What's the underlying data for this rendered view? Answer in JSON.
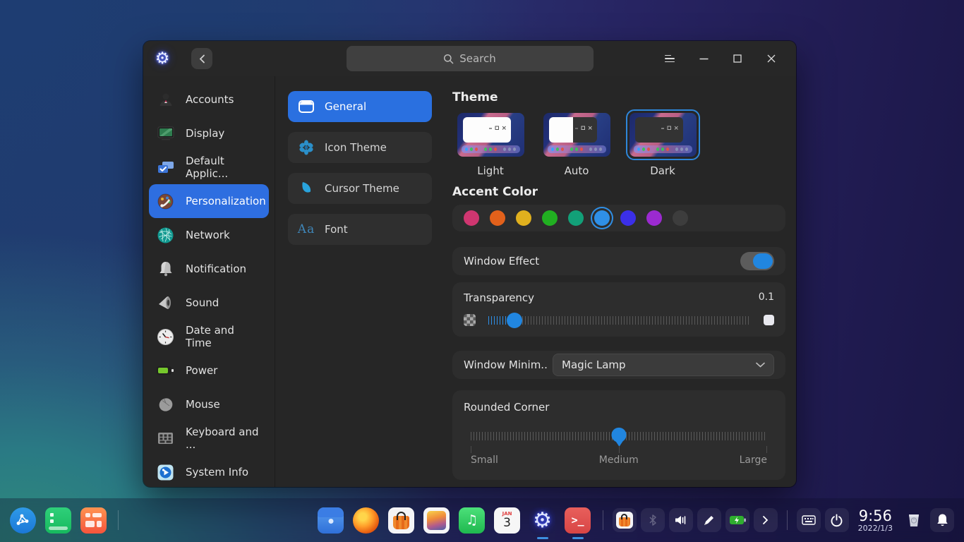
{
  "titlebar": {
    "search_placeholder": "Search"
  },
  "sidebar": {
    "items": [
      {
        "icon": "user-icon",
        "label": "Accounts"
      },
      {
        "icon": "display-icon",
        "label": "Display"
      },
      {
        "icon": "default-apps-icon",
        "label": "Default Applic..."
      },
      {
        "icon": "personalization-icon",
        "label": "Personalization",
        "selected": true
      },
      {
        "icon": "network-icon",
        "label": "Network"
      },
      {
        "icon": "notification-icon",
        "label": "Notification"
      },
      {
        "icon": "sound-icon",
        "label": "Sound"
      },
      {
        "icon": "clock-icon",
        "label": "Date and Time"
      },
      {
        "icon": "battery-icon",
        "label": "Power"
      },
      {
        "icon": "mouse-icon",
        "label": "Mouse"
      },
      {
        "icon": "keyboard-icon",
        "label": "Keyboard and ..."
      },
      {
        "icon": "system-info-icon",
        "label": "System Info"
      }
    ]
  },
  "subnav": {
    "selected": "General",
    "items": [
      {
        "icon": "window-icon",
        "label": "General"
      },
      {
        "icon": "flower-icon",
        "label": "Icon Theme"
      },
      {
        "icon": "cursor-icon",
        "label": "Cursor Theme"
      },
      {
        "icon": "font-icon",
        "label": "Font",
        "icon_text": "Aa"
      }
    ]
  },
  "content": {
    "theme": {
      "title": "Theme",
      "selected": "Dark",
      "options": [
        {
          "label": "Light"
        },
        {
          "label": "Auto"
        },
        {
          "label": "Dark"
        }
      ]
    },
    "accent": {
      "title": "Accent Color",
      "colors": [
        "#cf3670",
        "#e2611b",
        "#e0b01e",
        "#21b021",
        "#12a078",
        "#2f8fe6",
        "#3b2fe8",
        "#9b2ad0",
        "#3d3d3d"
      ],
      "selected_index": 5
    },
    "window_effect": {
      "label": "Window Effect",
      "enabled": true
    },
    "transparency": {
      "label": "Transparency",
      "value": "0.1",
      "percent": 10
    },
    "minimize_effect": {
      "label": "Window Minim...",
      "value": "Magic Lamp"
    },
    "rounded_corner": {
      "label": "Rounded Corner",
      "ticks": [
        "Small",
        "Medium",
        "Large"
      ],
      "selected": "Medium"
    }
  },
  "taskbar": {
    "pinned": [
      "launcher",
      "workspaces",
      "task-grid"
    ],
    "dock_apps": [
      "file-manager",
      "firefox",
      "app-store",
      "photos",
      "music",
      "calendar",
      "settings",
      "terminal"
    ],
    "running_apps": [
      "settings",
      "terminal"
    ],
    "tray": [
      "app-store-tray",
      "bluetooth",
      "volume",
      "color-picker",
      "battery",
      "expand"
    ],
    "clock": {
      "time": "9:56",
      "date": "2022/1/3"
    }
  }
}
